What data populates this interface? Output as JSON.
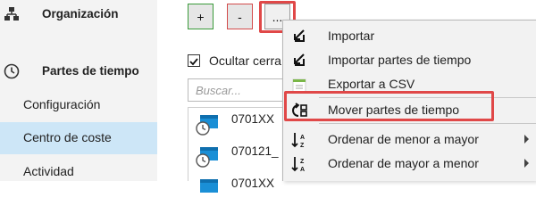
{
  "sidebar": {
    "org_label": "Organización",
    "parts_label": "Partes de tiempo",
    "items": [
      {
        "label": "Configuración"
      },
      {
        "label": "Centro de coste"
      },
      {
        "label": "Actividad"
      }
    ]
  },
  "toolbar": {
    "add_label": "+",
    "remove_label": "-",
    "more_label": "..."
  },
  "filter": {
    "hide_closed_label": "Ocultar cerra",
    "hide_closed_checked": true,
    "search_placeholder": "Buscar..."
  },
  "list": {
    "items": [
      {
        "text": "0701XX"
      },
      {
        "text": "070121_"
      },
      {
        "text": "0701XX"
      }
    ]
  },
  "context_menu": {
    "items": [
      {
        "label": "Importar",
        "icon": "import-icon"
      },
      {
        "label": "Importar partes de tiempo",
        "icon": "import-icon"
      },
      {
        "label": "Exportar a CSV",
        "icon": "export-csv-icon"
      },
      {
        "label": "Mover partes de tiempo",
        "icon": "move-icon"
      },
      {
        "label": "Ordenar de menor a mayor",
        "icon": "sort-ascending-icon",
        "submenu": true
      },
      {
        "label": "Ordenar de mayor a menor",
        "icon": "sort-descending-icon",
        "submenu": true
      }
    ]
  },
  "colors": {
    "highlight": "#e04848",
    "sidebar_active": "#cde6f7",
    "add_border": "#3a9a3a",
    "remove_border": "#d34b4b"
  }
}
